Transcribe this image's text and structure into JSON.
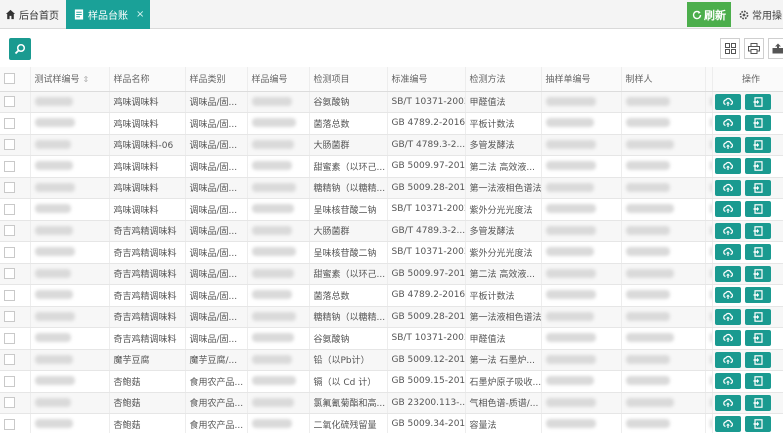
{
  "topbar": {
    "home_label": "后台首页",
    "active_tab_label": "样品台账",
    "close_glyph": "×",
    "refresh_label": "刷新",
    "common_label": "常用操"
  },
  "icons": {
    "home": "home-icon",
    "tab": "document-icon",
    "refresh": "refresh-icon",
    "common": "settings-icon",
    "search": "search-icon",
    "columns": "columns-icon",
    "print": "print-icon",
    "export": "export-icon",
    "upload": "upload-icon",
    "sign": "sign-in-icon"
  },
  "colors": {
    "accent": "#1aa198",
    "refresh": "#4cae4c",
    "op_button": "#1a9a90"
  },
  "table": {
    "headers": [
      "测试样编号",
      "样品名称",
      "样品类别",
      "样品编号",
      "检测项目",
      "标准编号",
      "检测方法",
      "抽样单编号",
      "制样人",
      "",
      "操作"
    ],
    "rows": [
      [
        "鸡味调味料",
        "调味品/固...",
        "谷氨酸钠",
        "SB/T 10371-2003",
        "甲醛值法"
      ],
      [
        "鸡味调味料",
        "调味品/固...",
        "菌落总数",
        "GB 4789.2-2016",
        "平板计数法"
      ],
      [
        "鸡味调味料-06",
        "调味品/固...",
        "大肠菌群",
        "GB/T 4789.3-2...",
        "多管发酵法"
      ],
      [
        "鸡味调味料",
        "调味品/固...",
        "甜蜜素（以环己...",
        "GB 5009.97-2016",
        "第二法 高效液..."
      ],
      [
        "鸡味调味料",
        "调味品/固...",
        "糖精钠（以糖精...",
        "GB 5009.28-2016",
        "第一法液相色谱法"
      ],
      [
        "鸡味调味料",
        "调味品/固...",
        "呈味核苷酸二钠",
        "SB/T 10371-2003",
        "紫外分光光度法"
      ],
      [
        "奇吉鸡精调味料",
        "调味品/固...",
        "大肠菌群",
        "GB/T 4789.3-2...",
        "多管发酵法"
      ],
      [
        "奇吉鸡精调味料",
        "调味品/固...",
        "呈味核苷酸二钠",
        "SB/T 10371-2003",
        "紫外分光光度法"
      ],
      [
        "奇吉鸡精调味料",
        "调味品/固...",
        "甜蜜素（以环己...",
        "GB 5009.97-2016",
        "第二法 高效液..."
      ],
      [
        "奇吉鸡精调味料",
        "调味品/固...",
        "菌落总数",
        "GB 4789.2-2016",
        "平板计数法"
      ],
      [
        "奇吉鸡精调味料",
        "调味品/固...",
        "糖精钠（以糖精...",
        "GB 5009.28-2016",
        "第一法液相色谱法"
      ],
      [
        "奇吉鸡精调味料",
        "调味品/固...",
        "谷氨酸钠",
        "SB/T 10371-2003",
        "甲醛值法"
      ],
      [
        "魔芋豆腐",
        "魔芋豆腐/...",
        "铅（以Pb计）",
        "GB 5009.12-2017",
        "第一法 石墨炉..."
      ],
      [
        "杏鲍菇",
        "食用农产品...",
        "镉（以 Cd 计）",
        "GB 5009.15-2014",
        "石墨炉原子吸收..."
      ],
      [
        "杏鲍菇",
        "食用农产品...",
        "氯氟氰菊酯和高...",
        "GB 23200.113-...",
        "气相色谱-质谱/..."
      ],
      [
        "杏鲍菇",
        "食用农产品...",
        "二氧化硫残留量",
        "GB 5009.34-2016",
        "容量法"
      ]
    ]
  }
}
